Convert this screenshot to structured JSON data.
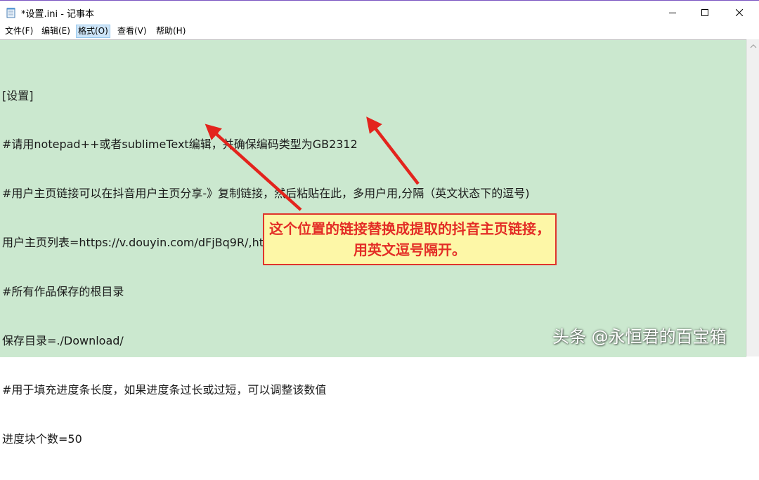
{
  "window": {
    "title": "*设置.ini - 记事本",
    "controls": {
      "minimize": "minimize-icon",
      "maximize": "maximize-icon",
      "close": "close-icon"
    }
  },
  "menu": {
    "file": "文件(F)",
    "edit": "编辑(E)",
    "format": "格式(O)",
    "view": "查看(V)",
    "help": "帮助(H)"
  },
  "editor": {
    "background": "#cbe8cf",
    "lines": [
      "[设置]",
      "#请用notepad++或者sublimeText编辑，并确保编码类型为GB2312",
      "#用户主页链接可以在抖音用户主页分享-》复制链接，然后粘贴在此，多用户用,分隔（英文状态下的逗号)",
      "用户主页列表=https://v.douyin.com/dFjBq9R/,https://v.douyin.com/dFjBq9R/",
      "#所有作品保存的根目录",
      "保存目录=./Download/",
      "#用于填充进度条长度，如果进度条过长或过短，可以调整该数值",
      "进度块个数=50"
    ]
  },
  "annotation": {
    "callout_text": "这个位置的链接替换成提取的抖音主页链接，用英文逗号隔开。",
    "color": "#e32d26",
    "fill": "#fdf7a7"
  },
  "watermark": "头条 @永恒君的百宝箱"
}
